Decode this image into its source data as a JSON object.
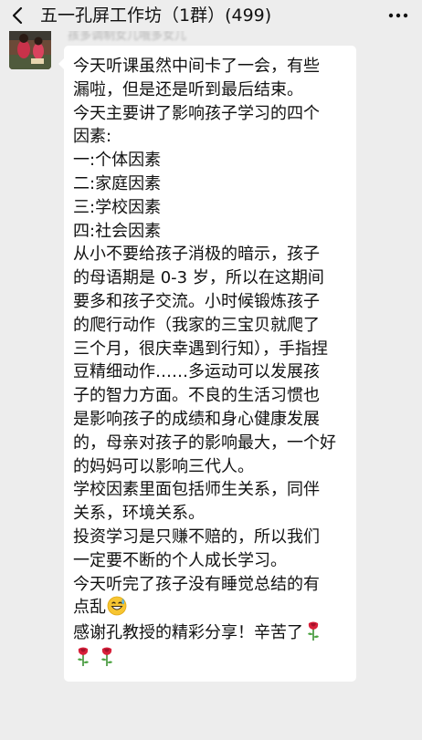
{
  "header": {
    "title": "五一孔屏工作坊（1群）(499)",
    "back_icon": "chevron-left-icon",
    "more_icon": "more-horizontal-icon"
  },
  "message": {
    "sender_name": "孩多调制女儿哦多女儿",
    "lines": [
      "今天听课虽然中间卡了一会，有些",
      "漏啦，但是还是听到最后结束。",
      "今天主要讲了影响孩子学习的四个",
      "因素:",
      "一:个体因素",
      "二:家庭因素",
      "三:学校因素",
      "四:社会因素",
      "从小不要给孩子消极的暗示，孩子",
      "的母语期是 0-3 岁，所以在这期间",
      "要多和孩子交流。小时候锻炼孩子",
      "的爬行动作（我家的三宝贝就爬了",
      "三个月，很庆幸遇到行知），手指捏",
      "豆精细动作……多运动可以发展孩",
      "子的智力方面。不良的生活习惯也",
      "是影响孩子的成绩和身心健康发展",
      "的，母亲对孩子的影响最大，一个好",
      "的妈妈可以影响三代人。",
      "学校因素里面包括师生关系，同伴",
      "关系，环境关系。",
      "投资学习是只赚不赔的，所以我们",
      "一定要不断的个人成长学习。",
      "今天听完了孩子没有睡觉总结的有",
      "点乱",
      "感谢孔教授的精彩分享！辛苦了"
    ],
    "emoji_after_line_24": "grinning-sweat-emoji",
    "emoji_rose": "rose-emoji"
  },
  "colors": {
    "chat_background": "#ededed",
    "bubble": "#ffffff",
    "text": "#111111"
  }
}
